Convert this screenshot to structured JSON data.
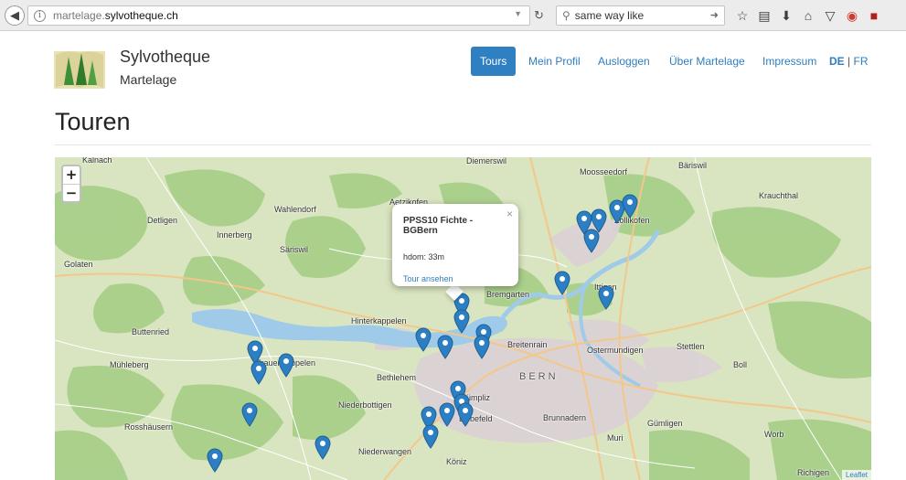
{
  "browser": {
    "url_domain": "martelage.",
    "url_host": "sylvotheque.ch",
    "search_value": "same way like"
  },
  "site": {
    "brand_name": "Sylvotheque",
    "brand_sub": "Martelage"
  },
  "nav": {
    "items": [
      {
        "label": "Tours",
        "active": true
      },
      {
        "label": "Mein Profil"
      },
      {
        "label": "Ausloggen"
      },
      {
        "label": "Über Martelage"
      },
      {
        "label": "Impressum"
      }
    ],
    "lang_de": "DE",
    "lang_sep": "|",
    "lang_fr": "FR"
  },
  "page": {
    "title": "Touren"
  },
  "map": {
    "zoom_in": "+",
    "zoom_out": "−",
    "attribution": "Leaflet",
    "places": [
      "Kalnach",
      "Diemerswil",
      "Moosseedorf",
      "Bäriswil",
      "Aetzikofen",
      "Wahlendorf",
      "Detligen",
      "Innerberg",
      "Säriswil",
      "Zollikofen",
      "Krauchthal",
      "Golaten",
      "Bremgarten",
      "Ittigen",
      "Hinterkappelen",
      "Buttenried",
      "Breitenrain",
      "Ostermundigen",
      "Stettlen",
      "Mühleberg",
      "Frauenkappelen",
      "Bethlehem",
      "Boll",
      "BERN",
      "Niederbottigen",
      "Bümpliz",
      "Liebefeld",
      "Brunnadern",
      "Gümligen",
      "Rosshäusern",
      "Muri",
      "Worb",
      "Niederwangen",
      "Köniz",
      "Richigen"
    ],
    "popup": {
      "title": "PPSS10 Fichte - BGBern",
      "text": "hdom: 33m",
      "link": "Tour ansehen",
      "close": "×"
    }
  }
}
